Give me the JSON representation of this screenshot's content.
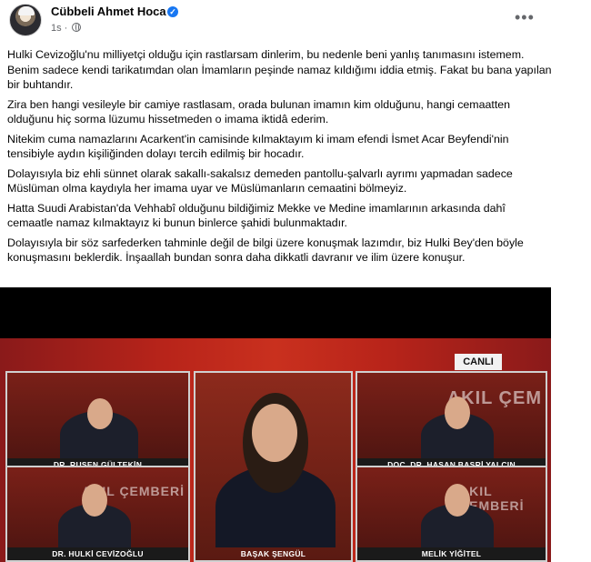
{
  "post": {
    "author": "Cübbeli Ahmet Hoca",
    "time": "1s",
    "more": "•••",
    "verified_icon": "verified-badge-icon",
    "privacy_icon": "globe-icon",
    "paragraphs": [
      "Hulki Cevizoğlu'nu milliyetçi olduğu için rastlarsam dinlerim, bu nedenle beni yanlış tanımasını istemem. Benim sadece kendi tarikatımdan olan İmamların peşinde namaz kıldığımı iddia etmiş. Fakat bu bana yapılan bir buhtandır.",
      "Zira ben hangi vesileyle bir camiye rastlasam, orada bulunan imamın kim olduğunu, hangi cemaatten olduğunu hiç sorma lüzumu hissetmeden o imama iktidâ ederim.",
      "Nitekim cuma namazlarını Acarkent'in camisinde kılmaktayım ki imam efendi İsmet Acar Beyfendi'nin tensibiyle aydın kişiliğinden dolayı tercih edilmiş bir hocadır.",
      "Dolayısıyla biz ehli sünnet olarak sakallı-sakalsız demeden pantollu-şalvarlı ayrımı yapmadan sadece Müslüman olma kaydıyla her imama uyar ve Müslümanların cemaatini bölmeyiz.",
      "Hatta Suudi Arabistan'da Vehhabî olduğunu bildiğimiz Mekke ve Medine imamlarının arkasında dahî cemaatle namaz kılmaktayız ki bunun binlerce şahidi bulunmaktadır.",
      "Dolayısıyla bir söz sarfederken tahminle değil de bilgi üzere konuşmak lazımdır, biz Hulki Bey'den böyle konuşmasını beklerdik. İnşaallah bundan sonra daha dikkatli davranır ve ilim üzere konuşur."
    ]
  },
  "video": {
    "live_label": "CANLI",
    "panelists": [
      "DR. RUŞEN GÜLTEKİN",
      "DOÇ. DR. HASAN BASRİ YALÇIN",
      "DR. HULKİ CEVİZOĞLU",
      "BAŞAK ŞENGÜL",
      "MELİK YİĞİTEL"
    ],
    "watermarks": [
      "AKIL ÇEM",
      "AKIL ÇEMBERİ",
      "AKIL ÇEMBERİ"
    ]
  }
}
